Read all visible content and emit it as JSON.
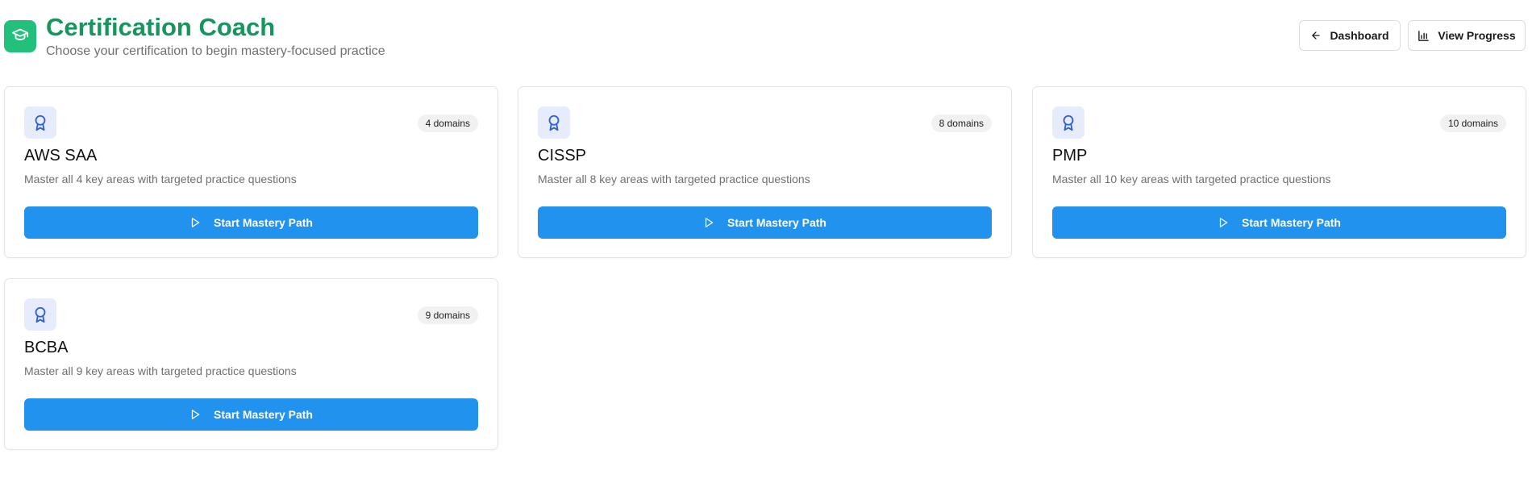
{
  "header": {
    "title": "Certification Coach",
    "subtitle": "Choose your certification to begin mastery-focused practice",
    "logo_icon": "graduation-cap-icon",
    "dashboard_label": "Dashboard",
    "dashboard_icon": "arrow-left-icon",
    "progress_label": "View Progress",
    "progress_icon": "bar-chart-icon"
  },
  "colors": {
    "brand_green": "#16955e",
    "logo_bg": "#22c07a",
    "primary_button": "#2192ee",
    "award_icon_bg": "#e6ecfb",
    "award_icon": "#2f5fd0"
  },
  "certifications": [
    {
      "name": "AWS SAA",
      "domains": "4 domains",
      "description": "Master all 4 key areas with targeted practice questions",
      "button_label": "Start Mastery Path",
      "icon": "award-ribbon-icon"
    },
    {
      "name": "CISSP",
      "domains": "8 domains",
      "description": "Master all 8 key areas with targeted practice questions",
      "button_label": "Start Mastery Path",
      "icon": "award-ribbon-icon"
    },
    {
      "name": "PMP",
      "domains": "10 domains",
      "description": "Master all 10 key areas with targeted practice questions",
      "button_label": "Start Mastery Path",
      "icon": "award-ribbon-icon"
    },
    {
      "name": "BCBA",
      "domains": "9 domains",
      "description": "Master all 9 key areas with targeted practice questions",
      "button_label": "Start Mastery Path",
      "icon": "award-ribbon-icon"
    }
  ]
}
